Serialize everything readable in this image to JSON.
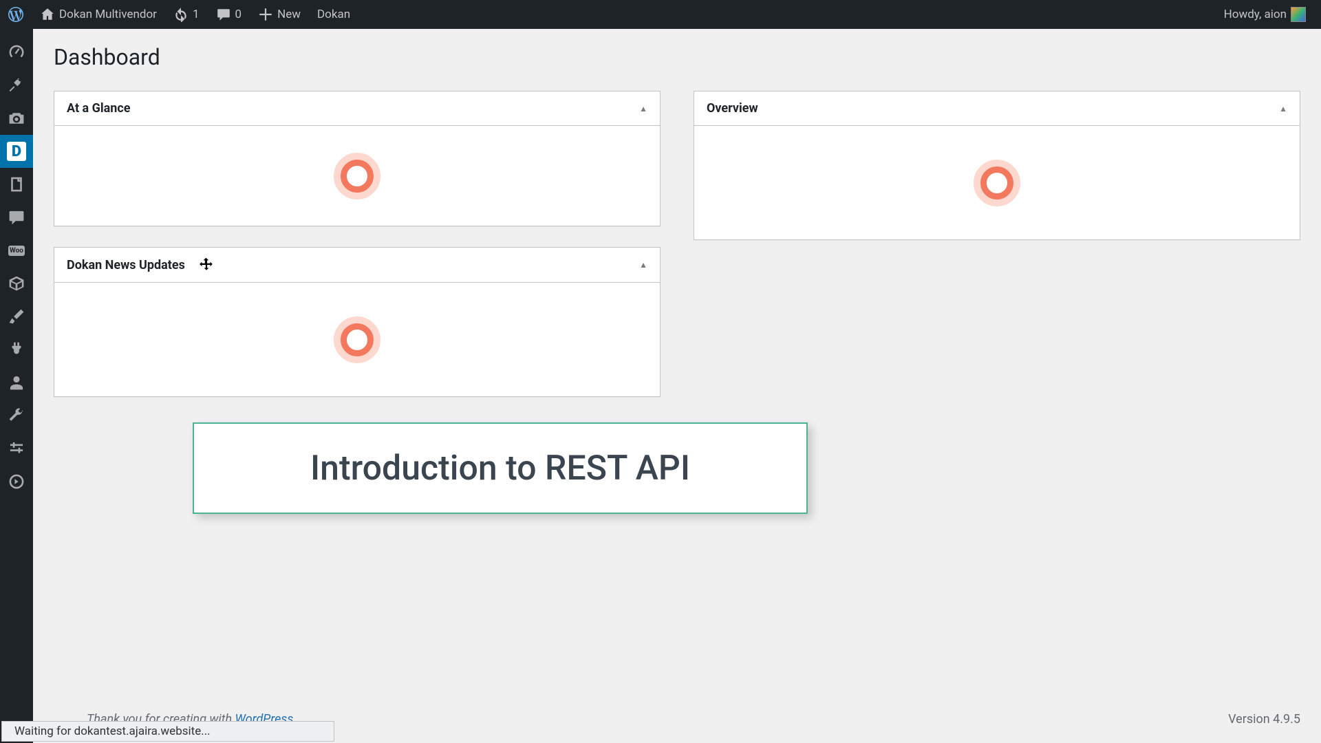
{
  "adminBar": {
    "siteName": "Dokan Multivendor",
    "updatesCount": "1",
    "commentsCount": "0",
    "newLabel": "New",
    "dokanLabel": "Dokan",
    "greeting": "Howdy, aion"
  },
  "sidebar": {
    "items": [
      {
        "name": "dashboard",
        "icon": "gauge"
      },
      {
        "name": "posts",
        "icon": "pin"
      },
      {
        "name": "media",
        "icon": "camera"
      },
      {
        "name": "dokan",
        "icon": "dokan",
        "active": true
      },
      {
        "name": "pages",
        "icon": "pages"
      },
      {
        "name": "comments",
        "icon": "comment"
      },
      {
        "name": "woocommerce",
        "icon": "woo"
      },
      {
        "name": "products",
        "icon": "box"
      },
      {
        "name": "appearance",
        "icon": "brush"
      },
      {
        "name": "plugins",
        "icon": "plug"
      },
      {
        "name": "users",
        "icon": "user"
      },
      {
        "name": "tools",
        "icon": "wrench"
      },
      {
        "name": "settings",
        "icon": "sliders"
      },
      {
        "name": "collapse",
        "icon": "collapse"
      }
    ]
  },
  "page": {
    "title": "Dashboard"
  },
  "metaboxes": {
    "glance": {
      "title": "At a Glance"
    },
    "news": {
      "title": "Dokan News Updates"
    },
    "overview": {
      "title": "Overview"
    }
  },
  "callout": {
    "text": "Introduction to REST API"
  },
  "footer": {
    "creditPrefix": "Thank you for creating with ",
    "creditLink": "WordPress",
    "creditSuffix": ".",
    "version": "Version 4.9.5"
  },
  "status": {
    "text": "Waiting for dokantest.ajaira.website..."
  }
}
